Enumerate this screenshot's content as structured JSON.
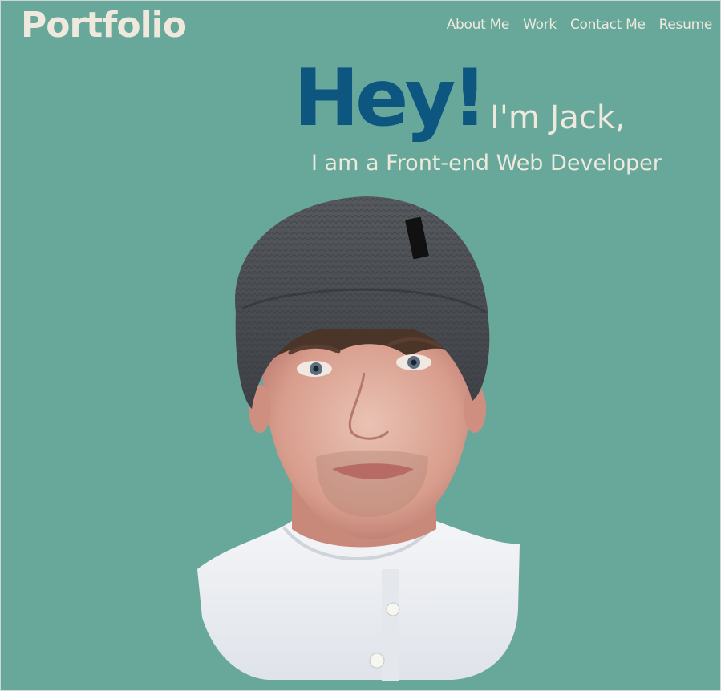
{
  "header": {
    "logo": "Portfolio",
    "nav": [
      {
        "label": "About Me"
      },
      {
        "label": "Work"
      },
      {
        "label": "Contact Me"
      },
      {
        "label": "Resume"
      }
    ]
  },
  "hero": {
    "greeting": "Hey!",
    "intro": "I'm Jack,",
    "subtitle": "I am a Front-end Web Developer"
  },
  "colors": {
    "background": "#68a89a",
    "accent": "#0d5680",
    "text": "#efe9dd"
  }
}
